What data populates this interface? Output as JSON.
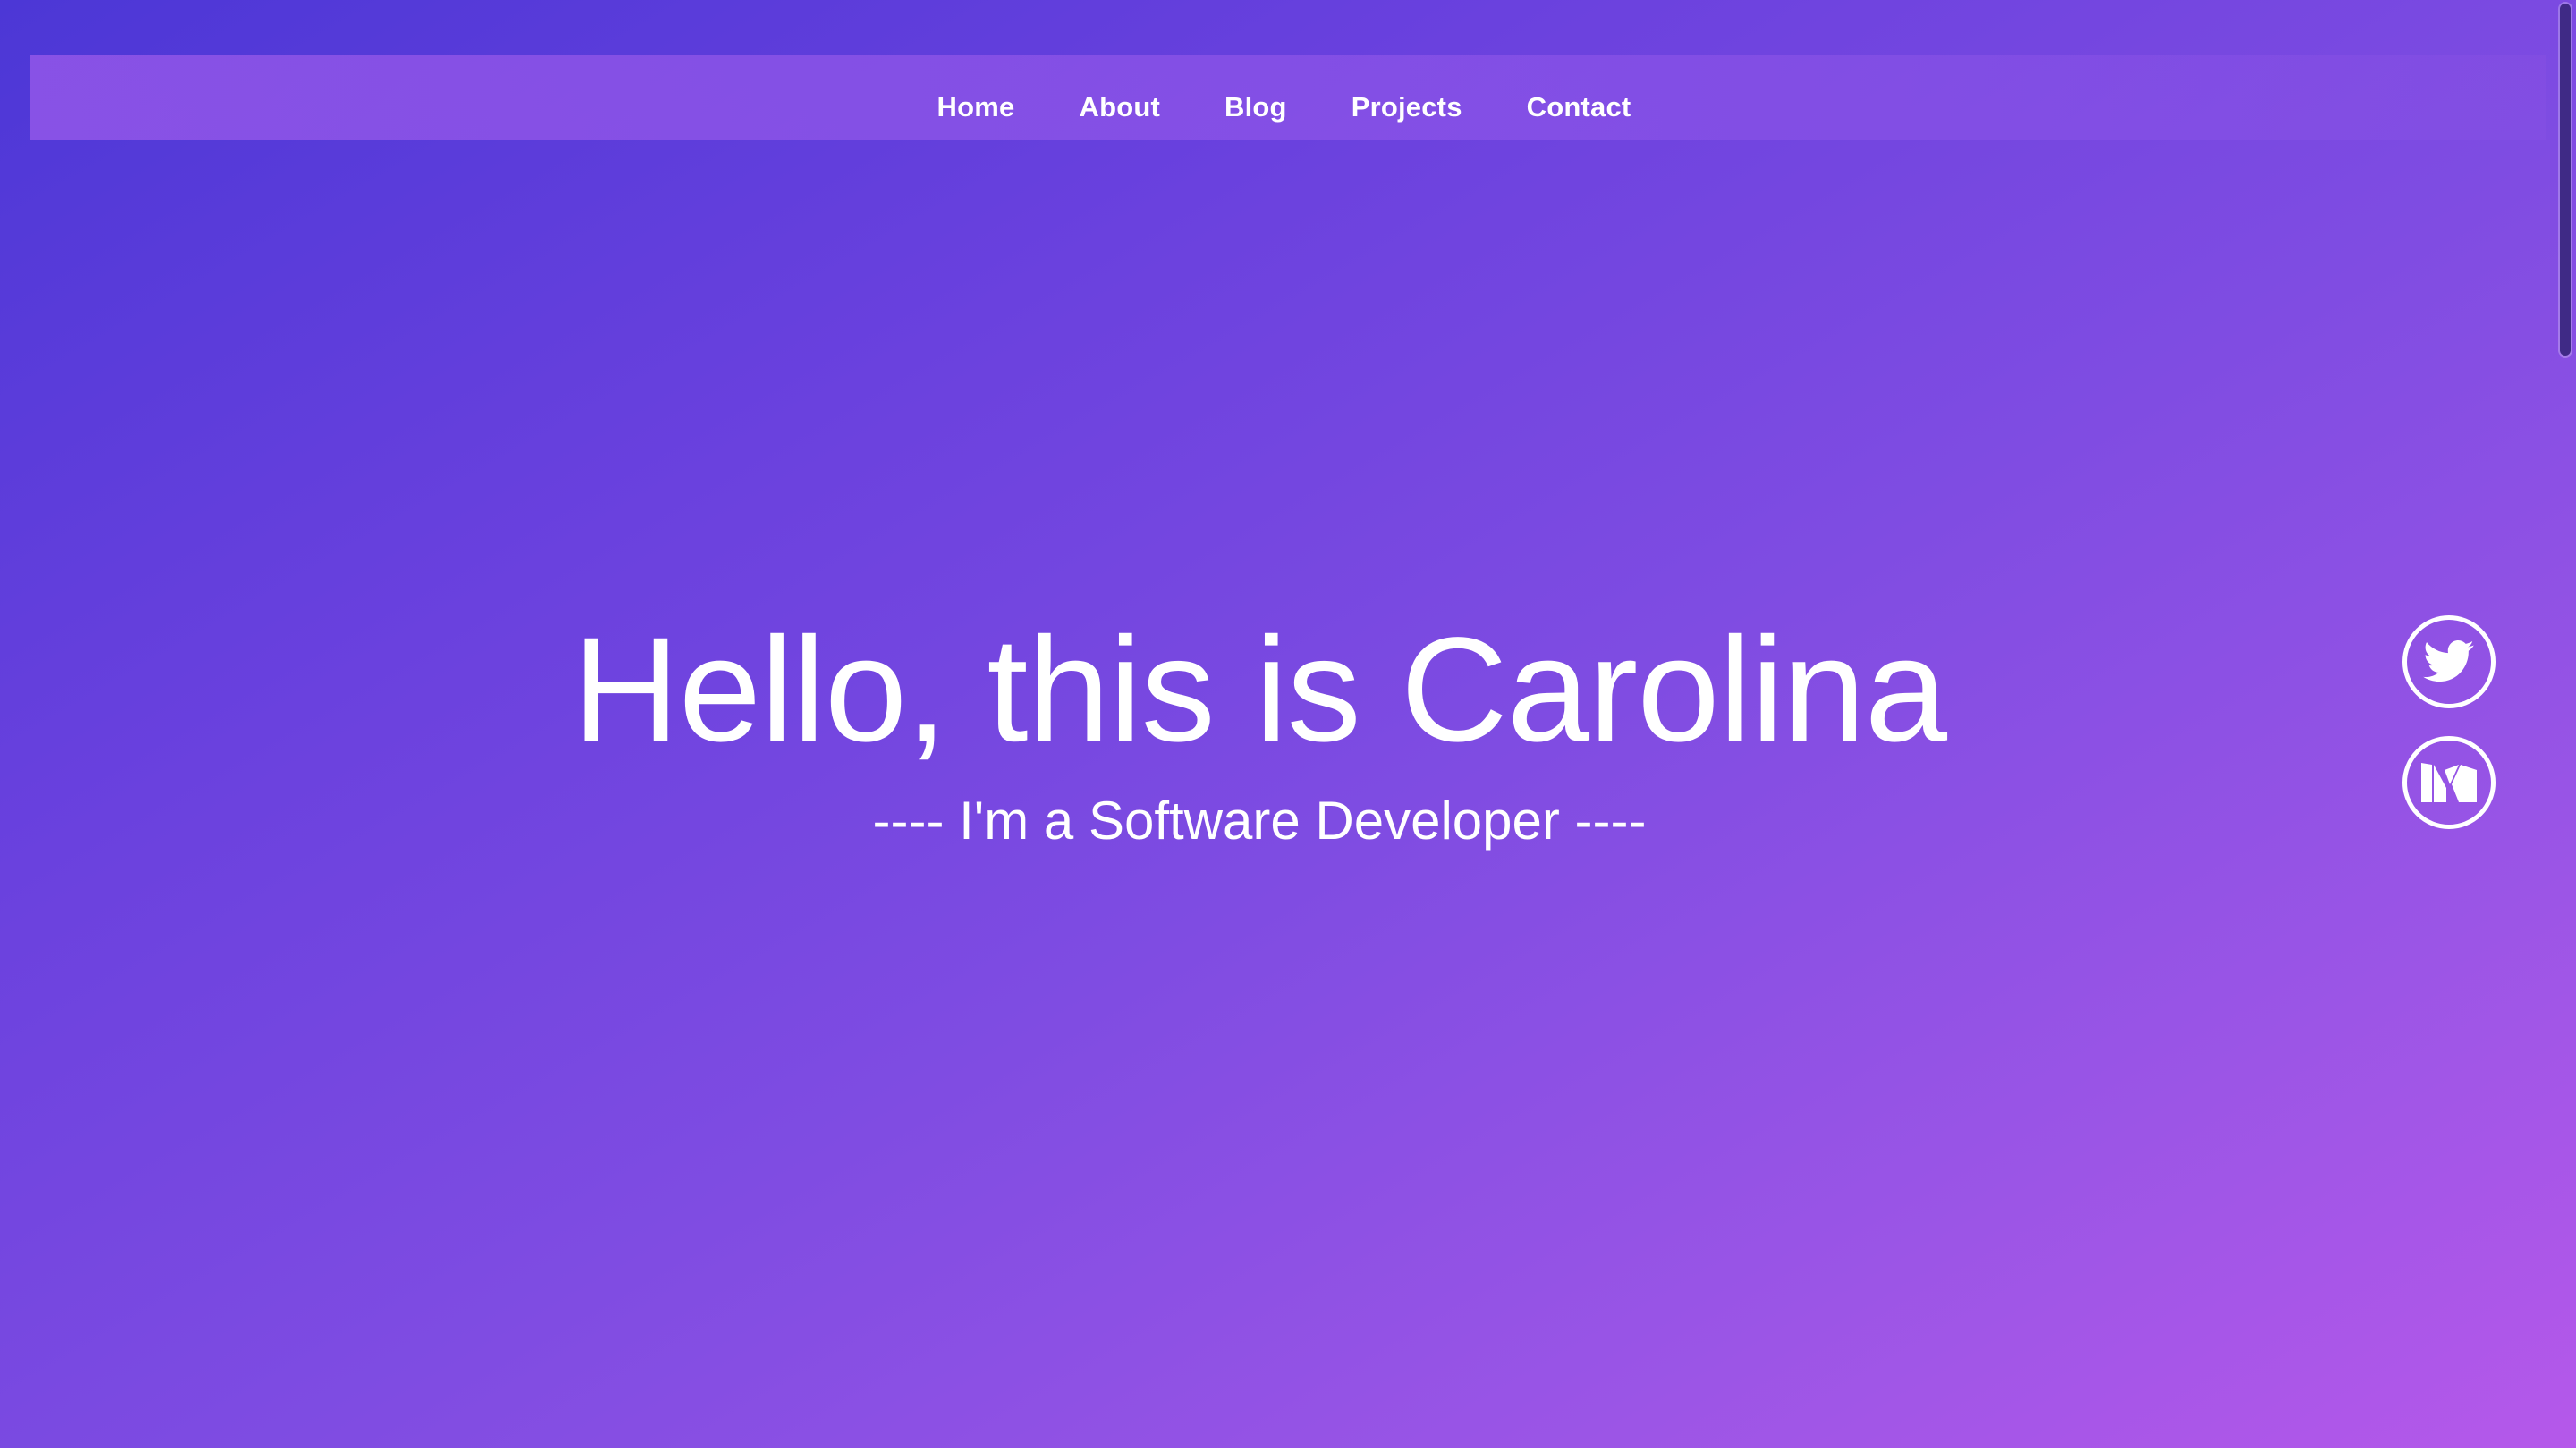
{
  "nav": {
    "items": [
      {
        "label": "Home"
      },
      {
        "label": "About"
      },
      {
        "label": "Blog"
      },
      {
        "label": "Projects"
      },
      {
        "label": "Contact"
      }
    ]
  },
  "hero": {
    "title": "Hello, this is Carolina",
    "subtitle": "---- I'm a Software Developer ----"
  },
  "social": {
    "icons": [
      "twitter-icon",
      "medium-icon"
    ]
  },
  "colors": {
    "gradient_start": "#4c37d6",
    "gradient_end": "#b558ea",
    "text": "#ffffff"
  }
}
